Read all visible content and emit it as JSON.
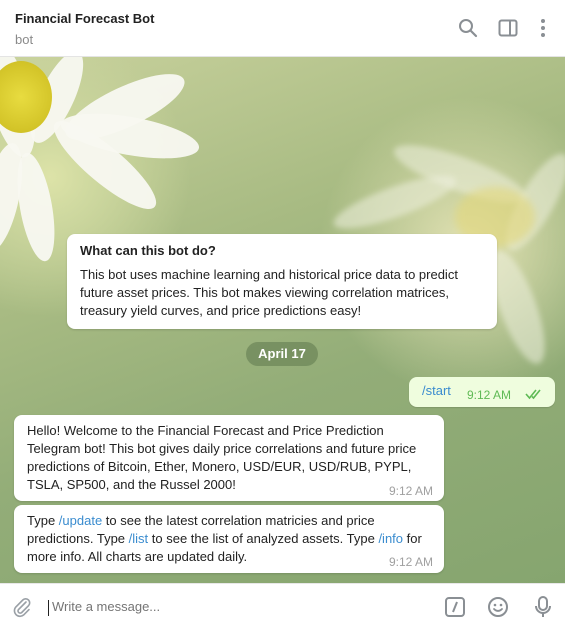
{
  "header": {
    "title": "Financial Forecast Bot",
    "subtitle": "bot"
  },
  "intro_card": {
    "heading": "What can this bot do?",
    "body": "This bot uses machine learning and historical price data to predict future asset prices. This bot makes viewing correlation matrices, treasury yield curves, and price predictions easy!"
  },
  "date_divider": "April 17",
  "messages": [
    {
      "direction": "outgoing",
      "text": "/start",
      "time": "9:12 AM",
      "status": "read"
    },
    {
      "direction": "incoming",
      "text": "Hello! Welcome to the Financial Forecast and Price Prediction Telegram bot! This bot gives daily price correlations and future price predictions of Bitcoin, Ether, Monero, USD/EUR, USD/RUB, PYPL, TSLA, SP500, and the Russel 2000!",
      "time": "9:12 AM"
    },
    {
      "direction": "incoming",
      "parts": {
        "p1": "Type ",
        "cmd1": "/update",
        "p2": " to see the latest correlation matricies and price predictions. Type ",
        "cmd2": "/list",
        "p3": " to see the list of analyzed assets. Type ",
        "cmd3": "/info",
        "p4": " for more info. All charts are updated daily."
      },
      "time": "9:12 AM"
    }
  ],
  "composer": {
    "placeholder": "Write a message..."
  },
  "colors": {
    "link": "#3a8ccf",
    "outgoing_bubble": "#effdde",
    "read_ticks": "#5fba55"
  },
  "icons": [
    "search-icon",
    "sidebar-toggle-icon",
    "more-vertical-icon",
    "attach-icon",
    "commands-icon",
    "emoji-icon",
    "microphone-icon",
    "double-check-icon"
  ]
}
